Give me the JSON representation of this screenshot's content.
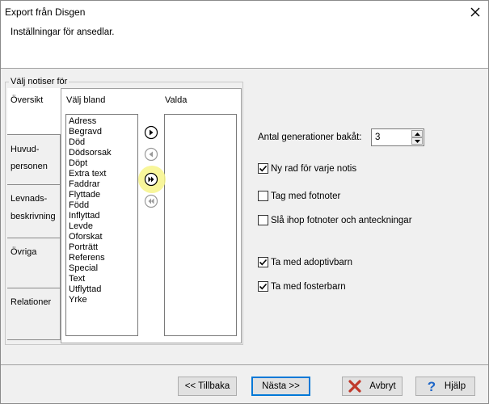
{
  "window": {
    "title": "Export från Disgen",
    "close_icon": "close-icon"
  },
  "header": {
    "text": "Inställningar för ansedlar."
  },
  "groupbox": {
    "legend": "Välj notiser för"
  },
  "tabs": [
    {
      "line1": "Översikt",
      "line2": ""
    },
    {
      "line1": "Huvud-",
      "line2": "personen"
    },
    {
      "line1": "Levnads-",
      "line2": "beskrivning"
    },
    {
      "line1": "Övriga",
      "line2": ""
    },
    {
      "line1": "Relationer",
      "line2": ""
    }
  ],
  "choose_from": {
    "label": "Välj bland",
    "items": [
      "Adress",
      "Begravd",
      "Död",
      "Dödsorsak",
      "Döpt",
      "Extra text",
      "Faddrar",
      "Flyttade",
      "Född",
      "Inflyttad",
      "Levde",
      "Oforskat",
      "Porträtt",
      "Referens",
      "Special",
      "Text",
      "Utflyttad",
      "Yrke"
    ]
  },
  "selected": {
    "label": "Valda",
    "items": []
  },
  "generations": {
    "label": "Antal generationer bakåt:",
    "value": "3"
  },
  "checkboxes": [
    {
      "label": "Ny rad för varje notis",
      "checked": true
    },
    {
      "label": "Tag med fotnoter",
      "checked": false
    },
    {
      "label": "Slå ihop fotnoter och anteckningar",
      "checked": false
    },
    {
      "label": "Ta med adoptivbarn",
      "checked": true
    },
    {
      "label": "Ta med fosterbarn",
      "checked": true
    }
  ],
  "footer": {
    "back_label": "<< Tillbaka",
    "next_label": "Nästa >>",
    "cancel_label": "Avbryt",
    "help_label": "Hjälp"
  },
  "colors": {
    "cancel_icon": "#c0392b",
    "help_icon": "#1e66c8",
    "highlight": "#f7f58a"
  }
}
